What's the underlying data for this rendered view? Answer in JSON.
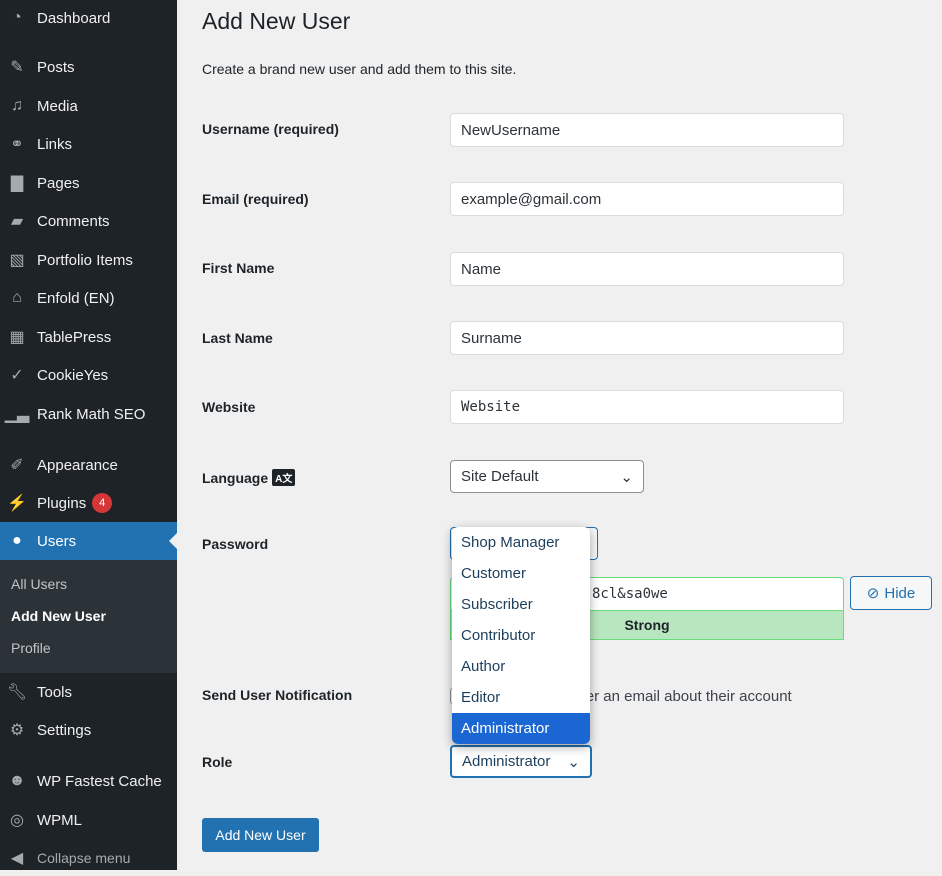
{
  "sidebar": {
    "items": [
      {
        "label": "Dashboard",
        "icon": "dashboard-icon"
      },
      {
        "label": "Posts",
        "icon": "pin-icon"
      },
      {
        "label": "Media",
        "icon": "media-icon"
      },
      {
        "label": "Links",
        "icon": "link-icon"
      },
      {
        "label": "Pages",
        "icon": "pages-icon"
      },
      {
        "label": "Comments",
        "icon": "comment-icon"
      },
      {
        "label": "Portfolio Items",
        "icon": "portfolio-icon"
      },
      {
        "label": "Enfold (EN)",
        "icon": "home-icon"
      },
      {
        "label": "TablePress",
        "icon": "table-icon"
      },
      {
        "label": "CookieYes",
        "icon": "cookie-icon"
      },
      {
        "label": "Rank Math SEO",
        "icon": "chart-icon"
      },
      {
        "label": "Appearance",
        "icon": "brush-icon"
      },
      {
        "label": "Plugins",
        "icon": "plugin-icon",
        "badge": "4"
      },
      {
        "label": "Users",
        "icon": "user-icon"
      },
      {
        "label": "Tools",
        "icon": "wrench-icon"
      },
      {
        "label": "Settings",
        "icon": "settings-icon"
      },
      {
        "label": "WP Fastest Cache",
        "icon": "cheetah-icon"
      },
      {
        "label": "WPML",
        "icon": "wpml-icon"
      }
    ],
    "submenu": [
      "All Users",
      "Add New User",
      "Profile"
    ],
    "collapse": "Collapse menu"
  },
  "page": {
    "title": "Add New User",
    "subtitle": "Create a brand new user and add them to this site."
  },
  "form": {
    "username_label": "Username (required)",
    "username": "NewUsername",
    "email_label": "Email (required)",
    "email": "example@gmail.com",
    "first_label": "First Name",
    "first": "Name",
    "last_label": "Last Name",
    "last": "Surname",
    "website_label": "Website",
    "website": "Website",
    "language_label": "Language",
    "language": "Site Default",
    "password_label": "Password",
    "password_visible": "8cl&sa0we",
    "strength": "Strong",
    "hide": "Hide",
    "notify_label": "Send User Notification",
    "notify_text": "Send the new user an email about their account",
    "role_label": "Role",
    "role": "Administrator",
    "role_options": [
      "Shop Manager",
      "Customer",
      "Subscriber",
      "Contributor",
      "Author",
      "Editor",
      "Administrator"
    ],
    "submit": "Add New User"
  },
  "colors": {
    "sidebar": "#1d2327",
    "accent": "#2271b1",
    "strength": "#b8e6bf",
    "option_selected": "#1a66d2"
  }
}
